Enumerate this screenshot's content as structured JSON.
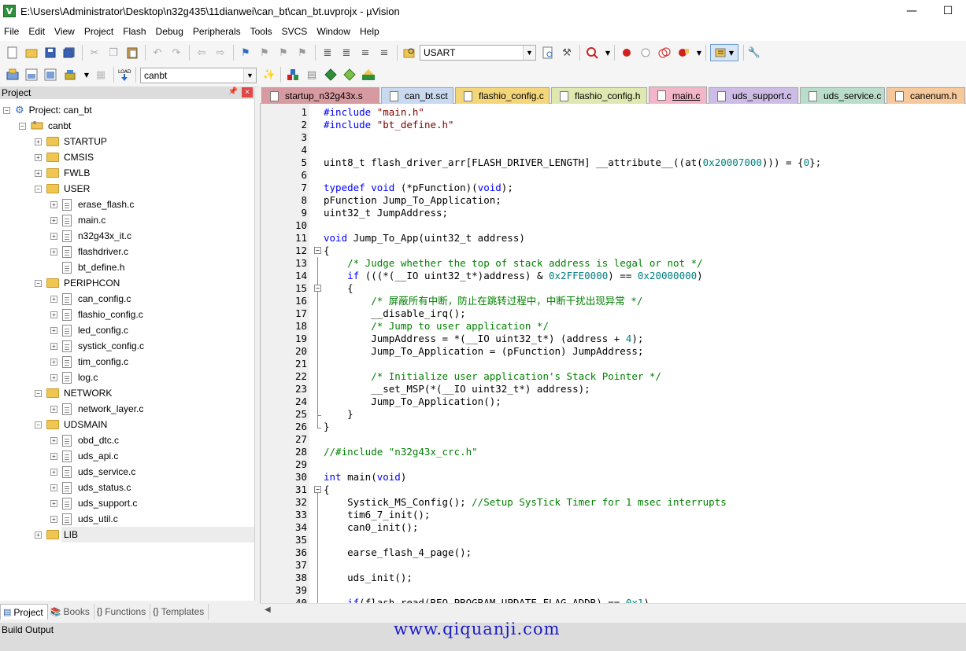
{
  "window": {
    "title": "E:\\Users\\Administrator\\Desktop\\n32g435\\11dianwei\\can_bt\\can_bt.uvprojx - µVision",
    "minimize_glyph": "—",
    "maximize_glyph": "☐"
  },
  "menu": [
    "File",
    "Edit",
    "View",
    "Project",
    "Flash",
    "Debug",
    "Peripherals",
    "Tools",
    "SVCS",
    "Window",
    "Help"
  ],
  "toolbar": {
    "find_combo_value": "USART",
    "target_combo_value": "canbt"
  },
  "project_panel": {
    "title": "Project",
    "pin_glyph": "📌",
    "close_glyph": "×",
    "root": "Project: can_bt",
    "target": "canbt",
    "groups": {
      "startup": "STARTUP",
      "cmsis": "CMSIS",
      "fwlb": "FWLB",
      "user": "USER",
      "periphcon": "PERIPHCON",
      "network": "NETWORK",
      "udsmain": "UDSMAIN",
      "lib": "LIB"
    },
    "user_files": [
      "erase_flash.c",
      "main.c",
      "n32g43x_it.c",
      "flashdriver.c",
      "bt_define.h"
    ],
    "periphcon_files": [
      "can_config.c",
      "flashio_config.c",
      "led_config.c",
      "systick_config.c",
      "tim_config.c",
      "log.c"
    ],
    "network_files": [
      "network_layer.c"
    ],
    "udsmain_files": [
      "obd_dtc.c",
      "uds_api.c",
      "uds_service.c",
      "uds_status.c",
      "uds_support.c",
      "uds_util.c"
    ]
  },
  "bottom_tabs": {
    "project": "Project",
    "books": "Books",
    "functions": "Functions",
    "templates": "Templates"
  },
  "file_tabs": [
    "startup_n32g43x.s",
    "can_bt.sct",
    "flashio_config.c",
    "flashio_config.h",
    "main.c",
    "uds_support.c",
    "uds_service.c",
    "canenum.h"
  ],
  "active_tab": "main.c",
  "tab_colors": [
    "#d69aa0",
    "#c9d9f0",
    "#f3d57a",
    "#dfe8b0",
    "#f3b6c9",
    "#cdbde6",
    "#b9dccb",
    "#f6c99c"
  ],
  "colors": {
    "keyword": "#0000ff",
    "string": "#800000",
    "number": "#008080",
    "comment": "#008000",
    "preproc": "#0000ff",
    "text": "#000000"
  },
  "code_lines": [
    {
      "n": "1",
      "t": [
        [
          "#include ",
          "preproc"
        ],
        [
          "\"main.h\"",
          "string"
        ]
      ]
    },
    {
      "n": "2",
      "t": [
        [
          "#include ",
          "preproc"
        ],
        [
          "\"bt_define.h\"",
          "string"
        ]
      ]
    },
    {
      "n": "3",
      "t": []
    },
    {
      "n": "4",
      "t": []
    },
    {
      "n": "5",
      "t": [
        [
          "uint8_t flash_driver_arr[FLASH_DRIVER_LENGTH] __attribute__((at(",
          "text"
        ],
        [
          "0x20007000",
          "number"
        ],
        [
          "))) = {",
          "text"
        ],
        [
          "0",
          "number"
        ],
        [
          "};",
          "text"
        ]
      ]
    },
    {
      "n": "6",
      "t": []
    },
    {
      "n": "7",
      "t": [
        [
          "typedef ",
          "keyword"
        ],
        [
          "void",
          "keyword"
        ],
        [
          " (*pFunction)(",
          "text"
        ],
        [
          "void",
          "keyword"
        ],
        [
          ");",
          "text"
        ]
      ]
    },
    {
      "n": "8",
      "t": [
        [
          "pFunction Jump_To_Application;",
          "text"
        ]
      ]
    },
    {
      "n": "9",
      "t": [
        [
          "uint32_t JumpAddress;",
          "text"
        ]
      ]
    },
    {
      "n": "10",
      "t": []
    },
    {
      "n": "11",
      "t": [
        [
          "void",
          "keyword"
        ],
        [
          " Jump_To_App(uint32_t address)",
          "text"
        ]
      ]
    },
    {
      "n": "12",
      "t": [
        [
          "{",
          "text"
        ]
      ]
    },
    {
      "n": "13",
      "t": [
        [
          "    /* Judge whether the top of stack address is legal or not */",
          "comment"
        ]
      ]
    },
    {
      "n": "14",
      "t": [
        [
          "    ",
          "text"
        ],
        [
          "if",
          "keyword"
        ],
        [
          " (((*(__IO uint32_t*)address) & ",
          "text"
        ],
        [
          "0x2FFE0000",
          "number"
        ],
        [
          ") == ",
          "text"
        ],
        [
          "0x20000000",
          "number"
        ],
        [
          ")",
          "text"
        ]
      ]
    },
    {
      "n": "15",
      "t": [
        [
          "    {",
          "text"
        ]
      ]
    },
    {
      "n": "16",
      "t": [
        [
          "        /* 屏蔽所有中断，防止在跳转过程中，中断干扰出现异常 */",
          "comment"
        ]
      ]
    },
    {
      "n": "17",
      "t": [
        [
          "        __disable_irq();",
          "text"
        ]
      ]
    },
    {
      "n": "18",
      "t": [
        [
          "        /* Jump to user application */",
          "comment"
        ]
      ]
    },
    {
      "n": "19",
      "t": [
        [
          "        JumpAddress = *(__IO uint32_t*) (address + ",
          "text"
        ],
        [
          "4",
          "number"
        ],
        [
          ");",
          "text"
        ]
      ]
    },
    {
      "n": "20",
      "t": [
        [
          "        Jump_To_Application = (pFunction) JumpAddress;",
          "text"
        ]
      ]
    },
    {
      "n": "21",
      "t": []
    },
    {
      "n": "22",
      "t": [
        [
          "        /* Initialize user application's Stack Pointer */",
          "comment"
        ]
      ]
    },
    {
      "n": "23",
      "t": [
        [
          "        __set_MSP(*(__IO uint32_t*) address);",
          "text"
        ]
      ]
    },
    {
      "n": "24",
      "t": [
        [
          "        Jump_To_Application();",
          "text"
        ]
      ]
    },
    {
      "n": "25",
      "t": [
        [
          "    }",
          "text"
        ]
      ]
    },
    {
      "n": "26",
      "t": [
        [
          "}",
          "text"
        ]
      ]
    },
    {
      "n": "27",
      "t": []
    },
    {
      "n": "28",
      "t": [
        [
          "//#include \"n32g43x_crc.h\"",
          "comment"
        ]
      ]
    },
    {
      "n": "29",
      "t": []
    },
    {
      "n": "30",
      "t": [
        [
          "int",
          "keyword"
        ],
        [
          " main(",
          "text"
        ],
        [
          "void",
          "keyword"
        ],
        [
          ")",
          "text"
        ]
      ]
    },
    {
      "n": "31",
      "t": [
        [
          "{",
          "text"
        ]
      ]
    },
    {
      "n": "32",
      "t": [
        [
          "    Systick_MS_Config(); ",
          "text"
        ],
        [
          "//Setup SysTick Timer for 1 msec interrupts",
          "comment"
        ]
      ]
    },
    {
      "n": "33",
      "t": [
        [
          "    tim6_7_init();",
          "text"
        ]
      ]
    },
    {
      "n": "34",
      "t": [
        [
          "    can0_init();",
          "text"
        ]
      ]
    },
    {
      "n": "35",
      "t": []
    },
    {
      "n": "36",
      "t": [
        [
          "    earse_flash_4_page();",
          "text"
        ]
      ]
    },
    {
      "n": "37",
      "t": []
    },
    {
      "n": "38",
      "t": [
        [
          "    uds_init();",
          "text"
        ]
      ]
    },
    {
      "n": "39",
      "t": []
    },
    {
      "n": "40",
      "t": [
        [
          "    ",
          "text"
        ],
        [
          "if",
          "keyword"
        ],
        [
          "(flash_read(REQ_PROGRAM_UPDATE_FLAG_ADDR) == ",
          "text"
        ],
        [
          "0x1",
          "number"
        ],
        [
          ")",
          "text"
        ]
      ]
    }
  ],
  "build_output": {
    "title": "Build Output"
  },
  "watermark": "www.qiquanji.com"
}
